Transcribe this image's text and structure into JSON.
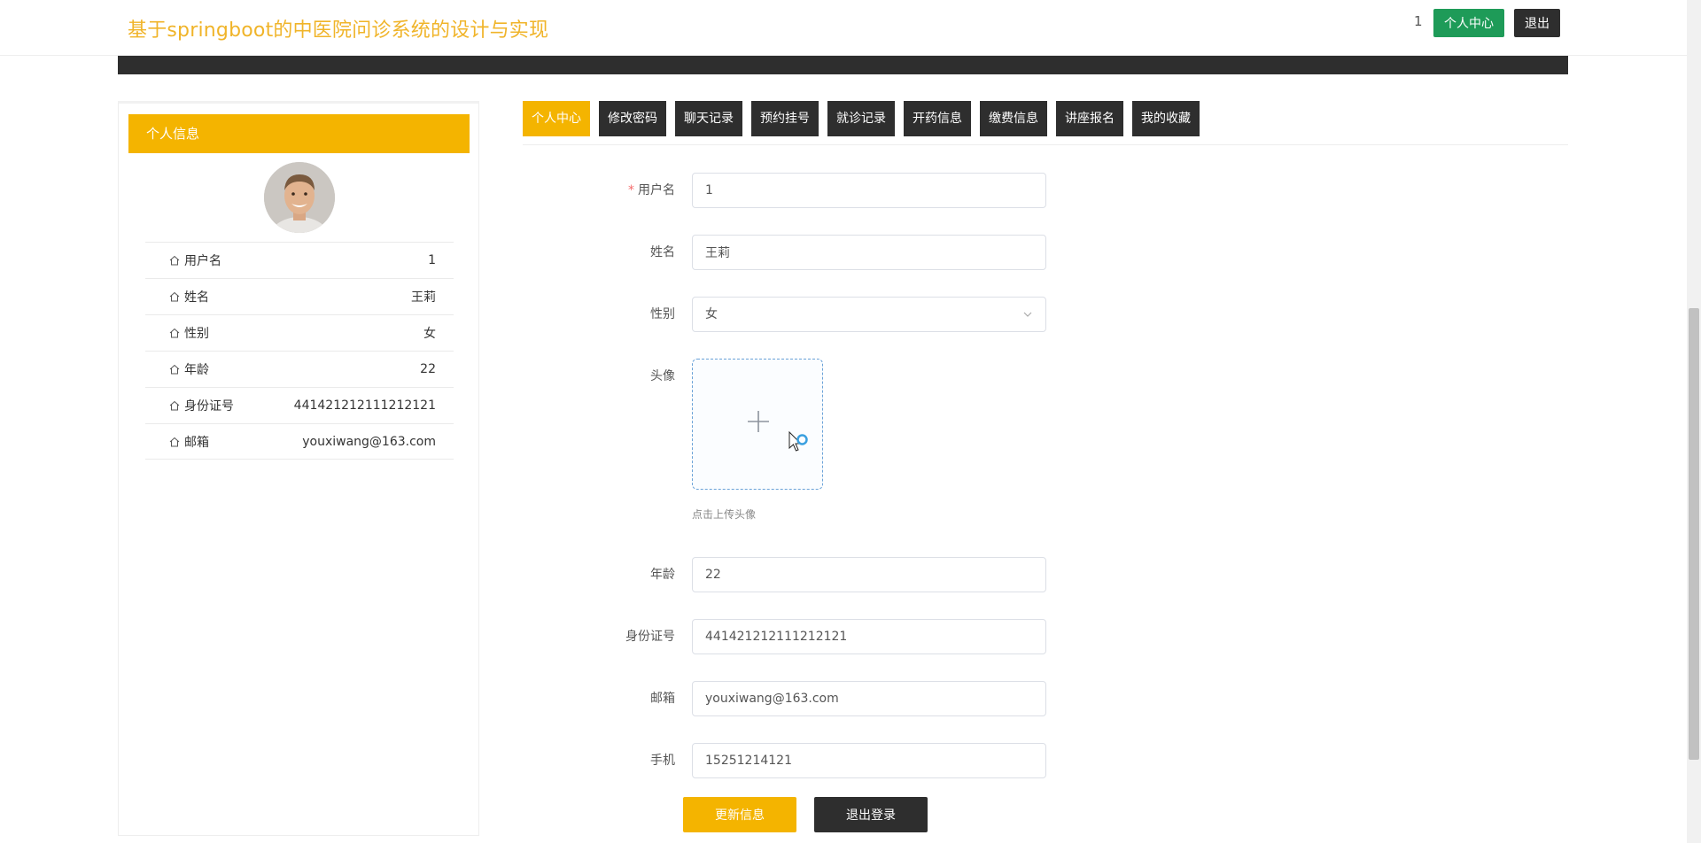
{
  "header": {
    "site_title": "基于springboot的中医院问诊系统的设计与实现",
    "user_id": "1",
    "center_label": "个人中心",
    "logout_label": "退出"
  },
  "colors": {
    "accent": "#f4b400",
    "green": "#1e9b58",
    "dark": "#2e2e2e",
    "title": "#f0b429"
  },
  "profile": {
    "heading": "个人信息",
    "avatar_icon": "avatar-photo",
    "items": [
      {
        "label": "用户名",
        "value": "1"
      },
      {
        "label": "姓名",
        "value": "王莉"
      },
      {
        "label": "性别",
        "value": "女"
      },
      {
        "label": "年龄",
        "value": "22"
      },
      {
        "label": "身份证号",
        "value": "441421212111212121"
      },
      {
        "label": "邮箱",
        "value": "youxiwang@163.com"
      }
    ]
  },
  "tabs": [
    {
      "label": "个人中心",
      "active": true
    },
    {
      "label": "修改密码"
    },
    {
      "label": "聊天记录"
    },
    {
      "label": "预约挂号"
    },
    {
      "label": "就诊记录"
    },
    {
      "label": "开药信息"
    },
    {
      "label": "缴费信息"
    },
    {
      "label": "讲座报名"
    },
    {
      "label": "我的收藏"
    }
  ],
  "form": {
    "username": {
      "label": "用户名",
      "value": "1"
    },
    "name": {
      "label": "姓名",
      "value": "王莉"
    },
    "gender": {
      "label": "性别",
      "value": "女"
    },
    "avatar": {
      "label": "头像",
      "tip": "点击上传头像"
    },
    "age": {
      "label": "年龄",
      "value": "22"
    },
    "id_number": {
      "label": "身份证号",
      "value": "441421212111212121"
    },
    "email": {
      "label": "邮箱",
      "value": "youxiwang@163.com"
    },
    "phone": {
      "label": "手机",
      "value": "15251214121"
    },
    "update_label": "更新信息",
    "signout_label": "退出登录"
  }
}
